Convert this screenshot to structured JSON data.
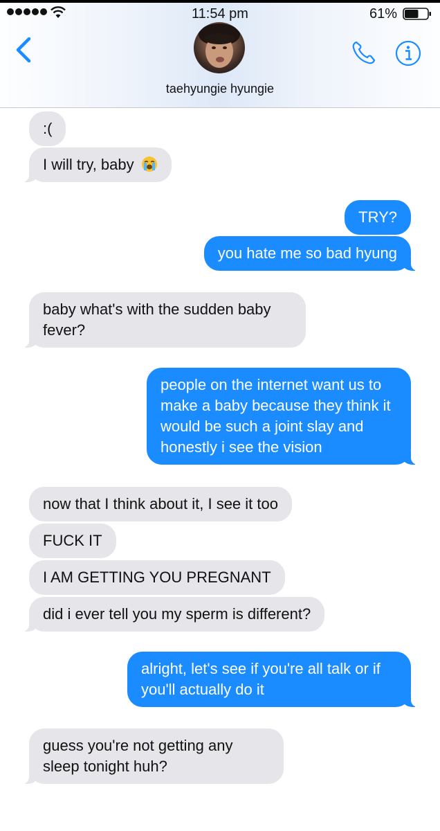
{
  "status_bar": {
    "time": "11:54 pm",
    "battery_percent": "61%",
    "battery_level": 0.61,
    "signal_bars": 5
  },
  "header": {
    "contact_name": "taehyungie hyungie",
    "back_icon": "chevron-left-icon",
    "call_icon": "phone-icon",
    "info_icon": "info-icon",
    "accent_color": "#1a8cff"
  },
  "messages": [
    {
      "sender": "them",
      "text": ":("
    },
    {
      "sender": "them",
      "text": "I will try, baby",
      "emoji": "loudly-crying-face"
    },
    {
      "sender": "me",
      "text": "TRY?"
    },
    {
      "sender": "me",
      "text": "you hate me so bad hyung"
    },
    {
      "sender": "them",
      "text": "baby what's with the sudden baby fever?"
    },
    {
      "sender": "me",
      "text": "people on the internet want us to make a baby because they think it would be such a joint slay and honestly i see the vision"
    },
    {
      "sender": "them",
      "text": "now that I think about it, I see it too"
    },
    {
      "sender": "them",
      "text": "FUCK IT"
    },
    {
      "sender": "them",
      "text": "I AM GETTING YOU PREGNANT"
    },
    {
      "sender": "them",
      "text": "did i ever tell you my sperm is different?"
    },
    {
      "sender": "me",
      "text": "alright, let's see if you're all talk or if you'll actually do it"
    },
    {
      "sender": "them",
      "text": "guess you're not getting any sleep tonight huh?"
    }
  ],
  "colors": {
    "incoming_bubble": "#e5e5ea",
    "outgoing_bubble": "#1a8cff"
  }
}
